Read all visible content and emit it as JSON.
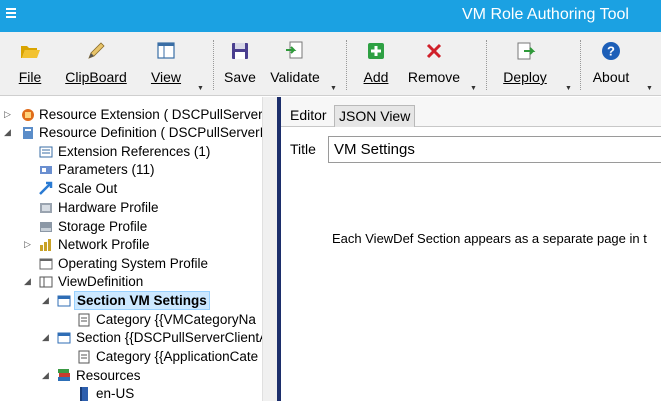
{
  "window": {
    "title": "VM Role Authoring Tool"
  },
  "toolbar": {
    "buttons": [
      {
        "label": "File",
        "icon": "folder-open-icon"
      },
      {
        "label": "ClipBoard",
        "icon": "pencil-icon"
      },
      {
        "label": "View",
        "icon": "window-layout-icon"
      },
      {
        "label": "Save",
        "icon": "floppy-disk-icon"
      },
      {
        "label": "Validate",
        "icon": "validate-document-icon"
      },
      {
        "label": "Add",
        "icon": "green-plus-icon"
      },
      {
        "label": "Remove",
        "icon": "red-x-icon"
      },
      {
        "label": "Deploy",
        "icon": "deploy-icon"
      },
      {
        "label": "About",
        "icon": "question-icon"
      }
    ]
  },
  "tree": {
    "items": [
      {
        "label": "Resource Extension ( DSCPullServerC",
        "icon": "resource-extension-icon"
      },
      {
        "label": "Resource Definition ( DSCPullServerI",
        "icon": "resource-definition-icon"
      },
      {
        "label": "Extension References (1)",
        "icon": "extension-references-icon"
      },
      {
        "label": "Parameters (11)",
        "icon": "parameters-icon"
      },
      {
        "label": "Scale Out",
        "icon": "scale-out-icon"
      },
      {
        "label": "Hardware Profile",
        "icon": "hardware-profile-icon"
      },
      {
        "label": "Storage Profile",
        "icon": "storage-profile-icon"
      },
      {
        "label": "Network Profile",
        "icon": "network-profile-icon"
      },
      {
        "label": "Operating System Profile",
        "icon": "os-profile-icon"
      },
      {
        "label": "ViewDefinition",
        "icon": "view-definition-icon"
      },
      {
        "label": "Section VM Settings",
        "icon": "section-icon"
      },
      {
        "label": "Category {{VMCategoryNa",
        "icon": "category-icon"
      },
      {
        "label": "Section {{DSCPullServerClientA",
        "icon": "section-icon"
      },
      {
        "label": "Category {{ApplicationCate",
        "icon": "category-icon"
      },
      {
        "label": "Resources",
        "icon": "resources-books-icon"
      },
      {
        "label": "en-US",
        "icon": "language-book-icon"
      }
    ]
  },
  "editor": {
    "tabs": [
      {
        "label": "Editor"
      },
      {
        "label": "JSON View"
      }
    ],
    "title_label": "Title",
    "title_value": "VM Settings",
    "info_text": "Each ViewDef Section appears as a separate page in t"
  }
}
